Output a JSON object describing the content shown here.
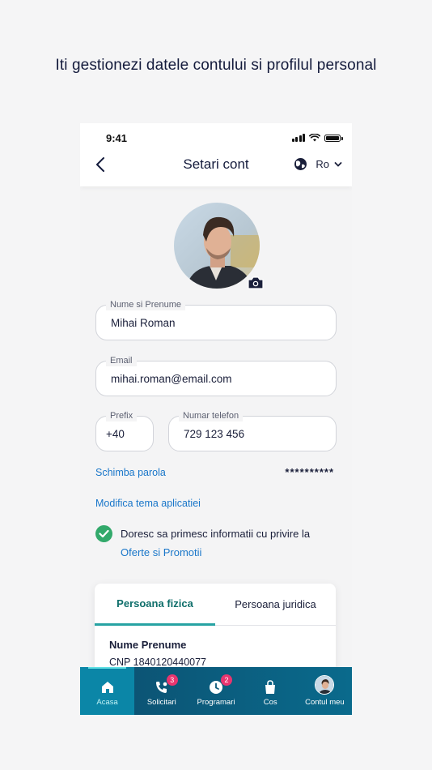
{
  "headline": "Iti gestionezi datele contului si profilul personal",
  "status": {
    "time": "9:41"
  },
  "header": {
    "title": "Setari cont",
    "language": "Ro"
  },
  "form": {
    "name": {
      "label": "Nume si Prenume",
      "value": "Mihai Roman"
    },
    "email": {
      "label": "Email",
      "value": "mihai.roman@email.com"
    },
    "prefix": {
      "label": "Prefix",
      "value": "+40"
    },
    "phone": {
      "label": "Numar telefon",
      "value": "729 123 456"
    }
  },
  "password": {
    "link": "Schimba parola",
    "mask": "**********"
  },
  "theme_link": "Modifica tema aplicatiei",
  "consent": {
    "text": "Doresc sa primesc informatii cu privire la",
    "link": "Oferte si Promotii",
    "checked": true
  },
  "card": {
    "tabs": [
      {
        "label": "Persoana fizica",
        "active": true
      },
      {
        "label": "Persoana juridica",
        "active": false
      }
    ],
    "name": "Nume Prenume",
    "cnp": "CNP 1840120440077"
  },
  "bottom_nav": [
    {
      "label": "Acasa",
      "icon": "home-icon",
      "active": true
    },
    {
      "label": "Solicitari",
      "icon": "phone-user-icon",
      "badge": "3"
    },
    {
      "label": "Programari",
      "icon": "clock-icon",
      "badge": "2"
    },
    {
      "label": "Cos",
      "icon": "bag-icon"
    },
    {
      "label": "Contul meu",
      "icon": "avatar"
    }
  ],
  "colors": {
    "accent": "#1976c9",
    "teal": "#27a3a3",
    "nav_bg": "#0c4f6f",
    "badge": "#e8356f",
    "check": "#32a96b"
  }
}
